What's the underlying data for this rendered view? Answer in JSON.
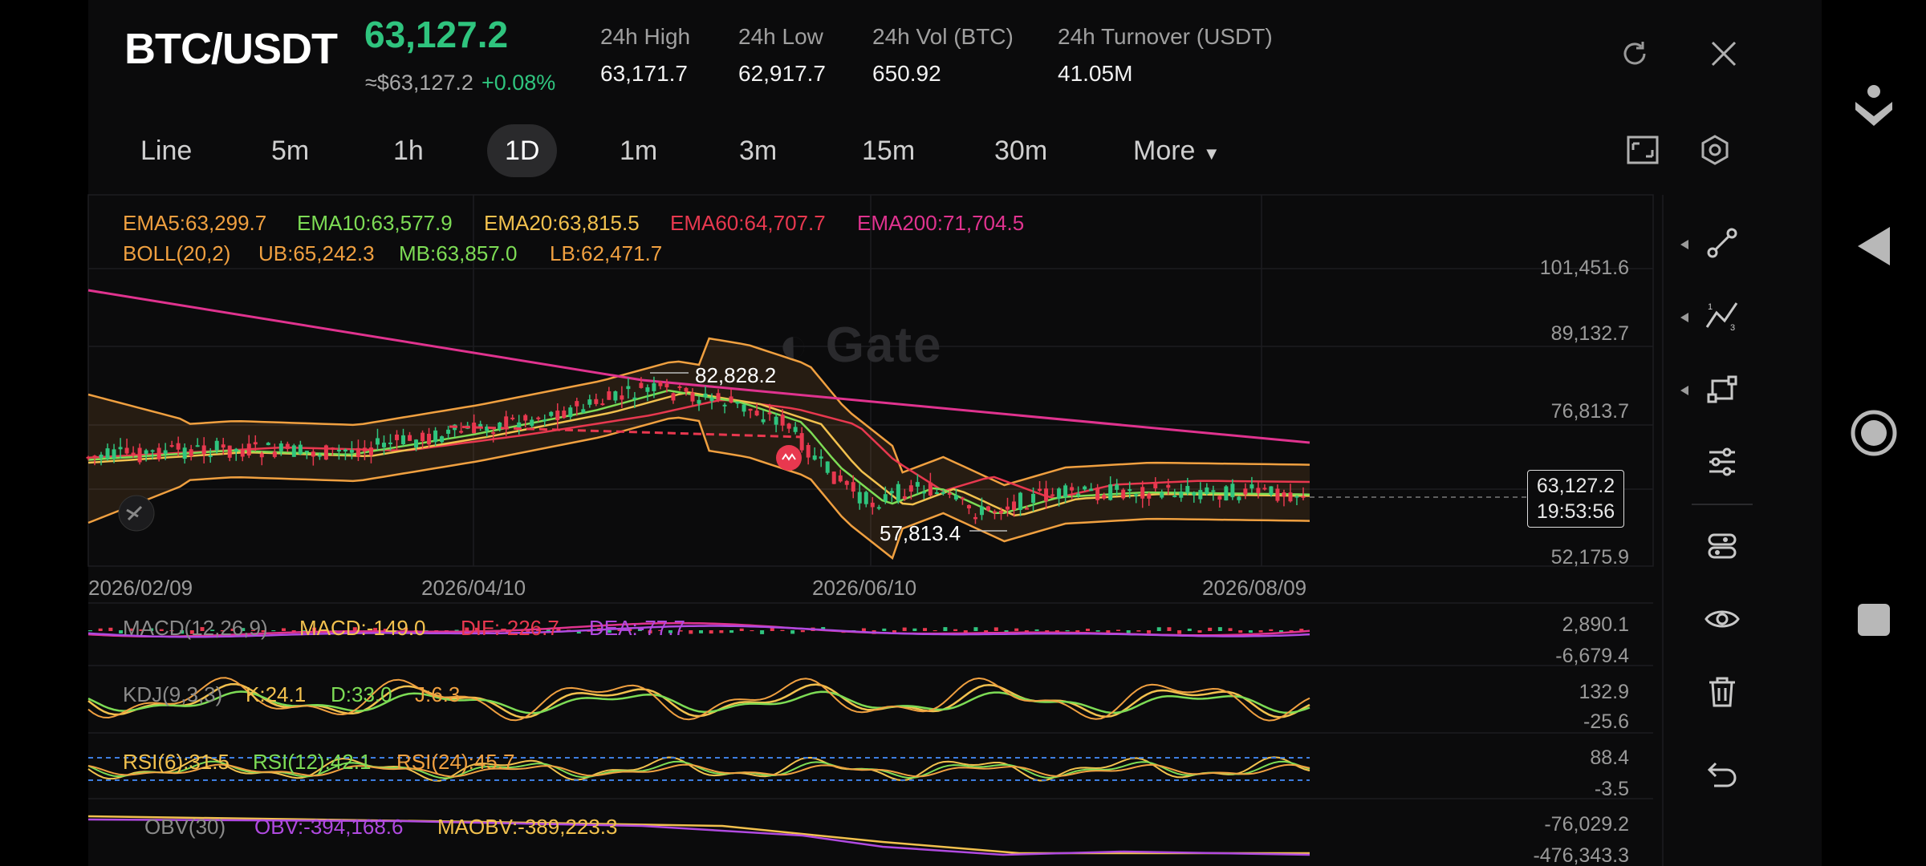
{
  "header": {
    "pair": "BTC/USDT",
    "price": "63,127.2",
    "approx": "≈$63,127.2",
    "change": "+0.08%",
    "stats": [
      {
        "label": "24h   High",
        "value": "63,171.7"
      },
      {
        "label": "24h   Low",
        "value": "62,917.7"
      },
      {
        "label": "24h   Vol (BTC)",
        "value": "650.92"
      },
      {
        "label": "24h   Turnover (USDT)",
        "value": "41.05M"
      }
    ]
  },
  "tabs": [
    "Line",
    "5m",
    "1h",
    "1D",
    "1m",
    "3m",
    "15m",
    "30m",
    "More"
  ],
  "active_tab": "1D",
  "main_indicators": {
    "ema5": "EMA5:63,299.7",
    "ema10": "EMA10:63,577.9",
    "ema20": "EMA20:63,815.5",
    "ema60": "EMA60:64,707.7",
    "ema200": "EMA200:71,704.5",
    "boll": "BOLL(20,2)",
    "ub": "UB:65,242.3",
    "mb": "MB:63,857.0",
    "lb": "LB:62,471.7"
  },
  "price_axis": [
    "101,451.6",
    "89,132.7",
    "76,813.7",
    "52,175.9"
  ],
  "last_price_tag": {
    "price": "63,127.2",
    "countdown": "19:53:56"
  },
  "annotations": {
    "high": "82,828.2",
    "low": "57,813.4"
  },
  "watermark": "Gate",
  "x_axis": [
    "2026/02/09",
    "2026/04/10",
    "2026/06/10",
    "2026/08/09"
  ],
  "macd": {
    "name": "MACD(12,26,9)",
    "macd": "MACD:-149.0",
    "dif": "DIF:-226.7",
    "dea": "DEA:-77.7",
    "axis_top": "2,890.1",
    "axis_bottom": "-6,679.4"
  },
  "kdj": {
    "name": "KDJ(9,3,3)",
    "k": "K:24.1",
    "d": "D:33.0",
    "j": "J:6.3",
    "axis_top": "132.9",
    "axis_bottom": "-25.6"
  },
  "rsi": {
    "r6": "RSI(6):31.5",
    "r12": "RSI(12):42.1",
    "r24": "RSI(24):45.7",
    "axis_top": "88.4",
    "axis_bottom": "-3.5"
  },
  "obv": {
    "name": "OBV(30)",
    "obv": "OBV:-394,168.6",
    "maobv": "MAOBV:-389,223.3",
    "axis_top": "-76,029.2",
    "axis_bottom": "-476,343.3"
  },
  "colors": {
    "up": "#2fc47e",
    "down": "#e8384f",
    "ema5": "#f0a040",
    "ema10": "#7ddc55",
    "ema20": "#f2c14e",
    "ema60": "#e8384f",
    "ema200": "#e0338f"
  },
  "icons": {
    "refresh": "refresh-icon",
    "close": "close-icon",
    "fullscreen": "fullscreen-icon",
    "settings": "settings-icon",
    "tools": [
      "line-segment-icon",
      "fib-icon",
      "shape-icon",
      "indicator-settings-icon",
      "layout-icon",
      "visibility-icon",
      "trash-icon",
      "undo-icon"
    ]
  }
}
